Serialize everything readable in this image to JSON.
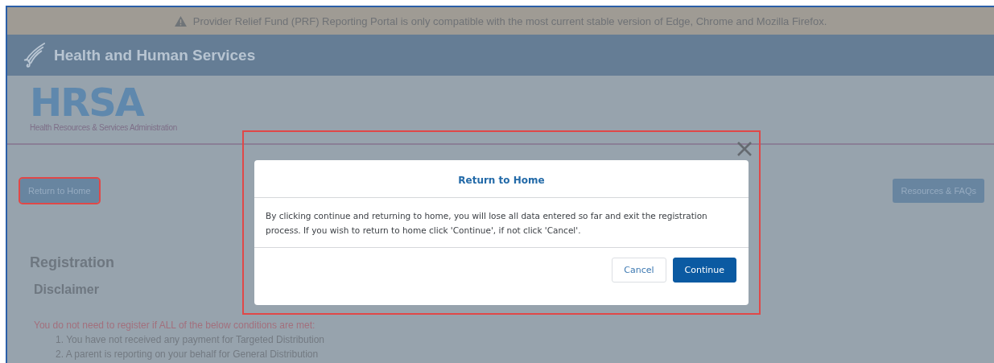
{
  "banner": {
    "text": "Provider Relief Fund (PRF) Reporting Portal is only compatible with the most current stable version of Edge, Chrome and Mozilla Firefox."
  },
  "header": {
    "title": "Health and Human Services"
  },
  "logo": {
    "mark": "HRSA",
    "subtitle": "Health Resources & Services Administration"
  },
  "nav": {
    "left_button": "Return to Home",
    "right_button": "Resources & FAQs"
  },
  "page": {
    "heading": "Registration",
    "subheading": "Disclaimer",
    "notice": "You do not need to register if ALL of the below conditions are met:",
    "conditions": [
      "1. You have not received any payment for Targeted Distribution",
      "2. A parent is reporting on your behalf for General Distribution"
    ]
  },
  "modal": {
    "title": "Return to Home",
    "body": "By clicking continue and returning to home, you will lose all data entered so far and exit the registration process. If you wish to return to home click 'Continue', if not click 'Cancel'.",
    "buttons": [
      {
        "label": "Cancel",
        "kind": "secondary"
      },
      {
        "label": "Continue",
        "kind": "primary"
      }
    ]
  }
}
